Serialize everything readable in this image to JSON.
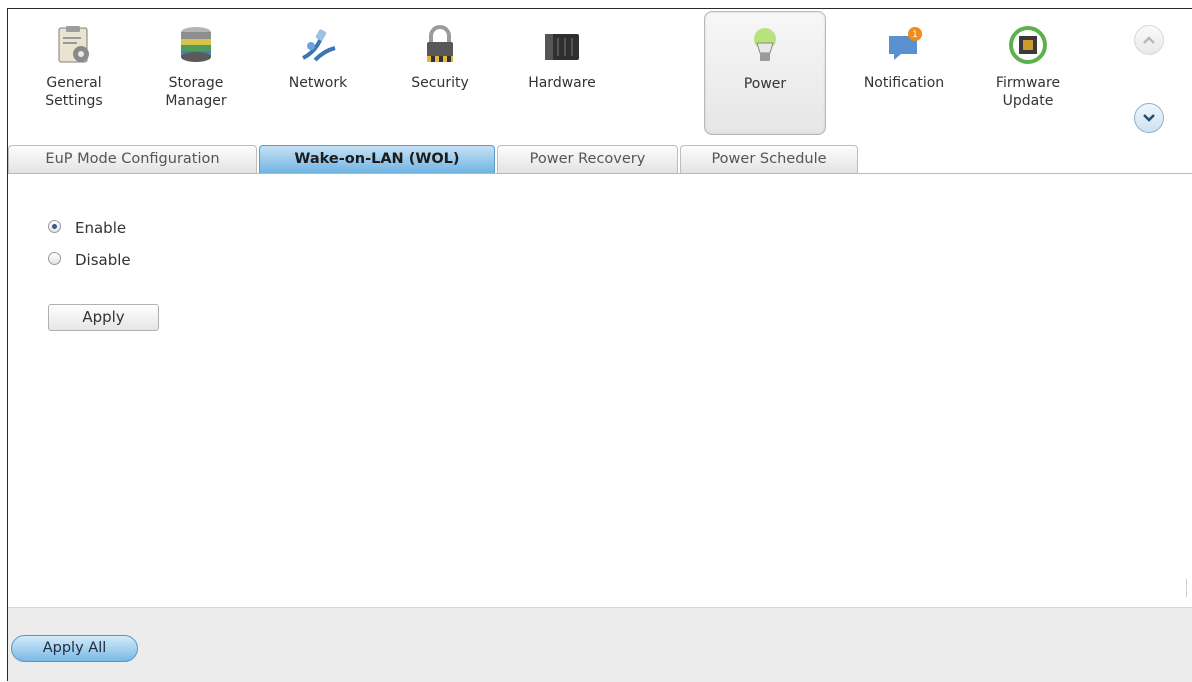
{
  "toolbar": {
    "items": [
      {
        "label": "General\nSettings",
        "icon": "clipboard-gear-icon"
      },
      {
        "label": "Storage\nManager",
        "icon": "disk-stack-icon"
      },
      {
        "label": "Network",
        "icon": "network-plug-icon"
      },
      {
        "label": "Security",
        "icon": "padlock-icon"
      },
      {
        "label": "Hardware",
        "icon": "nas-box-icon"
      },
      {
        "label": "Power",
        "icon": "lightbulb-icon"
      },
      {
        "label": "Notification",
        "icon": "speech-bubble-icon"
      },
      {
        "label": "Firmware\nUpdate",
        "icon": "chip-refresh-icon"
      }
    ],
    "active_index": 5
  },
  "tabs": [
    {
      "label": "EuP Mode Configuration"
    },
    {
      "label": "Wake-on-LAN (WOL)"
    },
    {
      "label": "Power Recovery"
    },
    {
      "label": "Power Schedule"
    }
  ],
  "active_tab": 1,
  "wol": {
    "options": [
      {
        "label": "Enable",
        "checked": true
      },
      {
        "label": "Disable",
        "checked": false
      }
    ],
    "apply_label": "Apply"
  },
  "footer": {
    "apply_all_label": "Apply All"
  },
  "colors": {
    "active_tab": "#70b4e3",
    "accent": "#5a9dc9"
  }
}
